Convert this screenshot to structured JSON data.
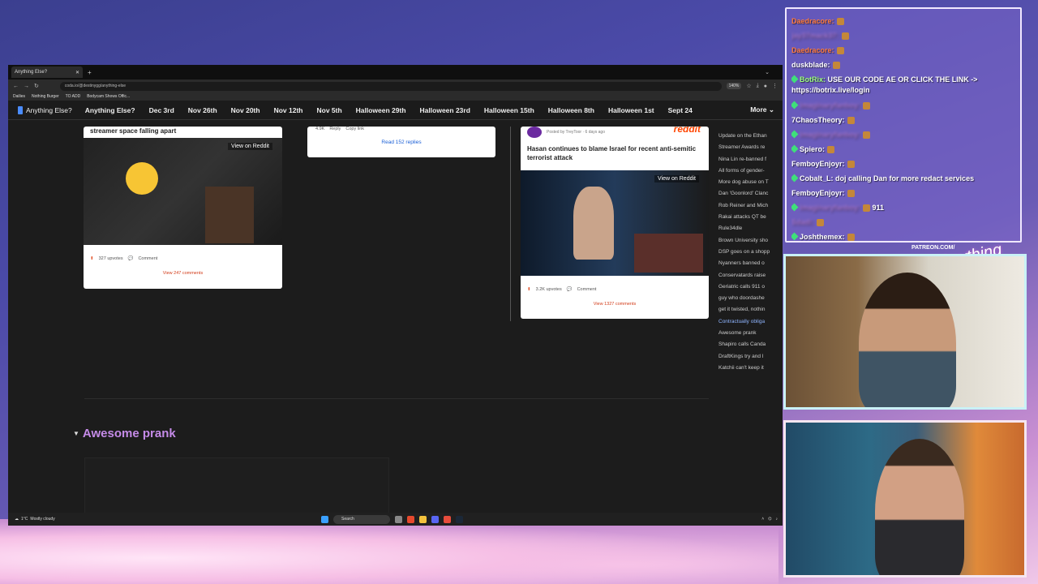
{
  "browser": {
    "tab_title": "Anything Else?",
    "url": "coda.io/@destinygg/anything-else",
    "zoom": "140%",
    "bookmarks": [
      "Dailies",
      "Nothing Burger",
      "TO ADD",
      "Bodycam Shows Offic..."
    ]
  },
  "nav": {
    "brand": "Anything Else?",
    "items": [
      "Anything Else?",
      "Dec 3rd",
      "Nov 26th",
      "Nov 20th",
      "Nov 12th",
      "Nov 5th",
      "Halloween 29th",
      "Halloween 23rd",
      "Halloween 15th",
      "Halloween 8th",
      "Halloween 1st",
      "Sept 24"
    ],
    "more": "More"
  },
  "posts": {
    "left": {
      "title": "streamer space falling apart",
      "view_button": "View on Reddit",
      "upvotes": "327 upvotes",
      "comment": "Comment",
      "view_comments": "View 247 comments"
    },
    "middle": {
      "count": "4.9K",
      "reply": "Reply",
      "copy": "Copy link",
      "read_replies": "Read 152 replies"
    },
    "right": {
      "posted_by": "Posted by TreyToor · 6 days ago",
      "brand": "reddit",
      "title": "Hasan continues to blame Israel for recent anti-semitic terrorist attack",
      "view_button": "View on Reddit",
      "upvotes": "3.2K upvotes",
      "comment": "Comment",
      "view_comments": "View 1327 comments"
    }
  },
  "section": {
    "title": "Awesome prank"
  },
  "toc": [
    "Update on the Ethan",
    "Streamer Awards re",
    "Nina Lin re-banned f",
    "All forms of gender-",
    "More dog abuse on T",
    "Dan 'Goonlord' Clanc",
    "Rob Reiner and Mich",
    "Rakai attacks QT be",
    "Rule34dle",
    "Brown University sho",
    "DSP goes on a shopp",
    "Nyanners banned o",
    "Conservatards raise",
    "Geriatric calls 911 o",
    "guy who doordashe",
    "get it twisted, nothin",
    "Contractually obliga",
    "Awesome prank",
    "Shapiro calls Canda",
    "DraftKings try and l",
    "Katchii can't keep it"
  ],
  "taskbar": {
    "weather_temp": "1°C",
    "weather_desc": "Mostly cloudy",
    "search": "Search"
  },
  "chat": [
    {
      "user": "Daedracore:",
      "text": "",
      "color": "orange"
    },
    {
      "user": "jay37mack37:",
      "text": "",
      "color": "blurred"
    },
    {
      "user": "Daedracore:",
      "text": "",
      "color": "orange"
    },
    {
      "user": "duskblade:",
      "text": "",
      "color": "white"
    },
    {
      "user": "BotRix:",
      "text": "USE OUR CODE AE OR CLICK THE LINK -> https://botrix.live/login",
      "color": "green",
      "wrap": true
    },
    {
      "user": "imaginaryfanboy:",
      "text": "",
      "color": "blurred"
    },
    {
      "user": "7ChaosTheory:",
      "text": "",
      "color": "white"
    },
    {
      "user": "imaginaryfanboy:",
      "text": "",
      "color": "blurred"
    },
    {
      "user": "Spiero:",
      "text": "",
      "color": "white"
    },
    {
      "user": "FemboyEnjoyr:",
      "text": "",
      "color": "white"
    },
    {
      "user": "Cobalt_L:",
      "text": "doj calling Dan for more redact services",
      "color": "white"
    },
    {
      "user": "FemboyEnjoyr:",
      "text": "",
      "color": "white"
    },
    {
      "user": "imaginaryfanboy:",
      "text": "911",
      "color": "blurred"
    },
    {
      "user": "Sdadi:",
      "text": "",
      "color": "blurred"
    },
    {
      "user": "Joshthemex:",
      "text": "",
      "color": "white"
    }
  ],
  "overlay": {
    "patreon": "PATREON.COM/",
    "signature": "Anything Else?"
  },
  "colors": {
    "accent_title": "#c58be8",
    "reddit": "#ff4500"
  }
}
